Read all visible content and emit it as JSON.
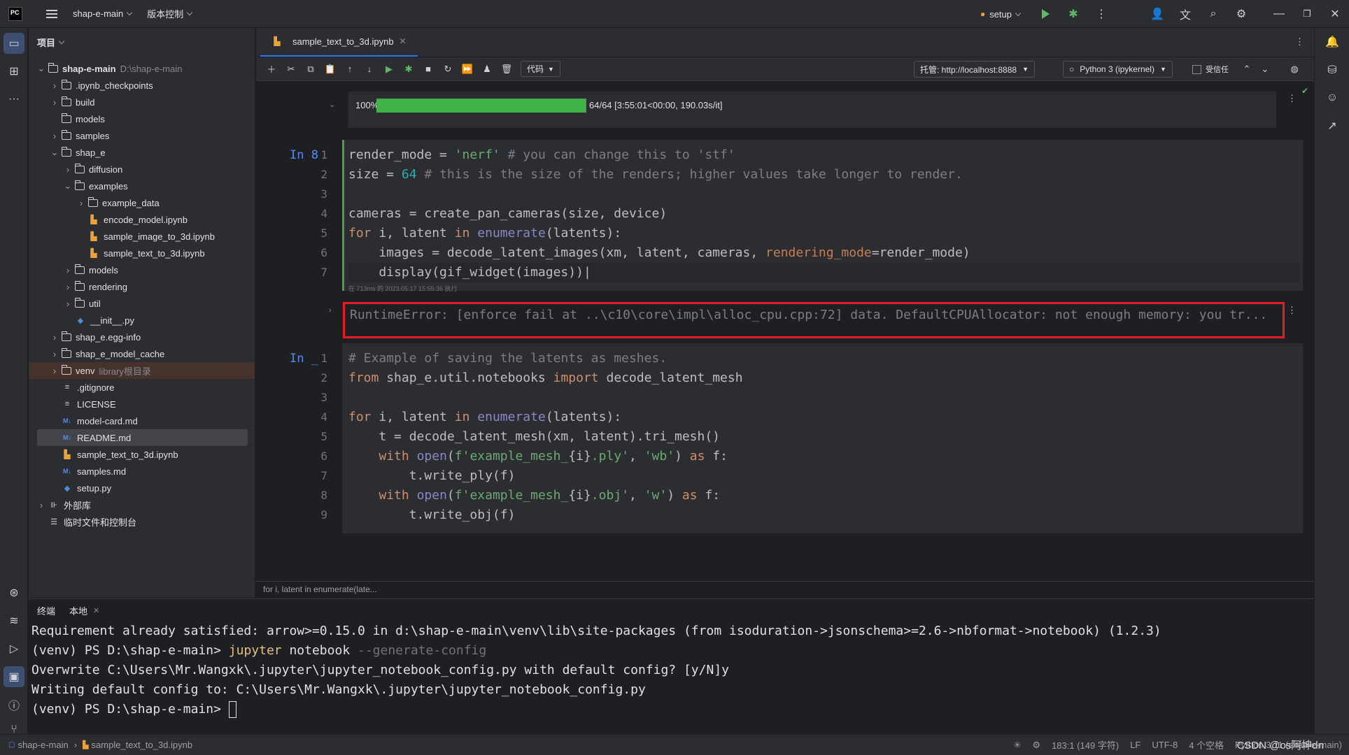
{
  "titlebar": {
    "logo": "PC",
    "project": "shap-e-main",
    "vcs": "版本控制",
    "run_config": "setup"
  },
  "project_panel": {
    "title": "项目",
    "tree": [
      {
        "label": "shap-e-main",
        "hint": "D:\\shap-e-main",
        "depth": 0,
        "type": "folder",
        "open": true
      },
      {
        "label": ".ipynb_checkpoints",
        "depth": 1,
        "type": "folder"
      },
      {
        "label": "build",
        "depth": 1,
        "type": "folder"
      },
      {
        "label": "models",
        "depth": 1,
        "type": "folder",
        "leaf": true
      },
      {
        "label": "samples",
        "depth": 1,
        "type": "folder"
      },
      {
        "label": "shap_e",
        "depth": 1,
        "type": "folder",
        "open": true
      },
      {
        "label": "diffusion",
        "depth": 2,
        "type": "folder"
      },
      {
        "label": "examples",
        "depth": 2,
        "type": "folder",
        "open": true
      },
      {
        "label": "example_data",
        "depth": 3,
        "type": "folder"
      },
      {
        "label": "encode_model.ipynb",
        "depth": 3,
        "type": "nb",
        "leaf": true
      },
      {
        "label": "sample_image_to_3d.ipynb",
        "depth": 3,
        "type": "nb",
        "leaf": true
      },
      {
        "label": "sample_text_to_3d.ipynb",
        "depth": 3,
        "type": "nb",
        "leaf": true
      },
      {
        "label": "models",
        "depth": 2,
        "type": "folder"
      },
      {
        "label": "rendering",
        "depth": 2,
        "type": "folder"
      },
      {
        "label": "util",
        "depth": 2,
        "type": "folder"
      },
      {
        "label": "__init__.py",
        "depth": 2,
        "type": "py",
        "leaf": true
      },
      {
        "label": "shap_e.egg-info",
        "depth": 1,
        "type": "folder"
      },
      {
        "label": "shap_e_model_cache",
        "depth": 1,
        "type": "folder"
      },
      {
        "label": "venv",
        "hint": "library根目录",
        "depth": 1,
        "type": "folder",
        "highlight": true
      },
      {
        "label": ".gitignore",
        "depth": 1,
        "type": "txt",
        "leaf": true
      },
      {
        "label": "LICENSE",
        "depth": 1,
        "type": "txt",
        "leaf": true
      },
      {
        "label": "model-card.md",
        "depth": 1,
        "type": "md",
        "leaf": true
      },
      {
        "label": "README.md",
        "depth": 1,
        "type": "md",
        "leaf": true,
        "selected": true
      },
      {
        "label": "sample_text_to_3d.ipynb",
        "depth": 1,
        "type": "nb",
        "leaf": true
      },
      {
        "label": "samples.md",
        "depth": 1,
        "type": "md",
        "leaf": true
      },
      {
        "label": "setup.py",
        "depth": 1,
        "type": "py",
        "leaf": true
      },
      {
        "label": "外部库",
        "depth": 0,
        "type": "lib"
      },
      {
        "label": "临时文件和控制台",
        "depth": 0,
        "type": "scratch",
        "leaf": true
      }
    ]
  },
  "editor": {
    "tab": "sample_text_to_3d.ipynb",
    "code_selector": "代码",
    "server": "托管: http://localhost:8888",
    "kernel": "Python 3 (ipykernel)",
    "trusted": "受信任",
    "progress": {
      "percent_label": "100%",
      "fraction": 1.0,
      "text": "64/64 [3:55:01<00:00, 190.03s/it]"
    },
    "cell1": {
      "prompt": "In 8",
      "lines": [
        "1",
        "2",
        "3",
        "4",
        "5",
        "6",
        "7"
      ],
      "exec_info": "在 713ms 的 2023.05.17 15:55:36 执行"
    },
    "error_text": "RuntimeError: [enforce fail at ..\\c10\\core\\impl\\alloc_cpu.cpp:72] data. DefaultCPUAllocator: not enough memory: you tr...",
    "cell2": {
      "prompt": "In _",
      "lines": [
        "1",
        "2",
        "3",
        "4",
        "5",
        "6",
        "7",
        "8",
        "9"
      ]
    },
    "breadcrumb": "for i, latent in enumerate(late..."
  },
  "terminal": {
    "tab_title": "终端",
    "tab_local": "本地",
    "lines": [
      "Requirement already satisfied: arrow>=0.15.0 in d:\\shap-e-main\\venv\\lib\\site-packages (from isoduration->jsonschema>=2.6->nbformat->notebook) (1.2.3)",
      "Overwrite C:\\Users\\Mr.Wangxk\\.jupyter\\jupyter_notebook_config.py with default config? [y/N]y",
      "Writing default config to: C:\\Users\\Mr.Wangxk\\.jupyter\\jupyter_notebook_config.py"
    ],
    "prompt": "(venv) PS D:\\shap-e-main> ",
    "cmd_exe": "jupyter",
    "cmd_arg": " notebook ",
    "cmd_flag": "--generate-config"
  },
  "statusbar": {
    "crumb_project": "shap-e-main",
    "crumb_file": "sample_text_to_3d.ipynb",
    "position": "183:1 (149 字符)",
    "line_sep": "LF",
    "encoding": "UTF-8",
    "indent": "4 个空格",
    "interpreter": "Python 3.11 (shap-e-main)",
    "watermark": "CSDN @os阿坤dn"
  }
}
